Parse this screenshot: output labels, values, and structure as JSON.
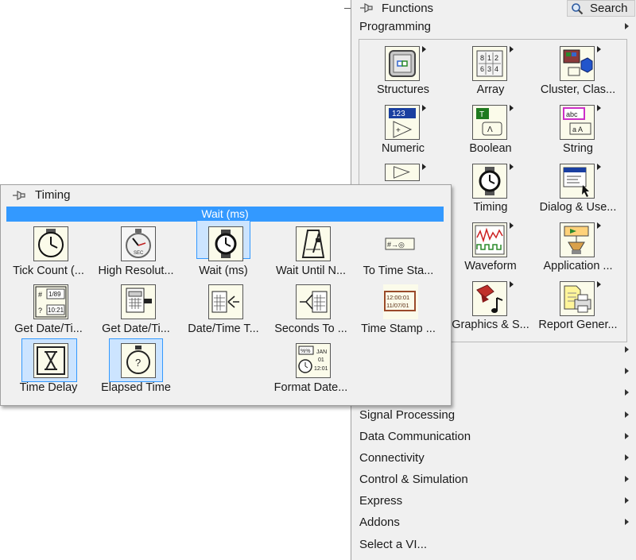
{
  "functions": {
    "title": "Functions",
    "search_label": "Search",
    "top_category": "Programming",
    "programming_items": [
      {
        "label": "Structures",
        "icon": "structures-icon"
      },
      {
        "label": "Array",
        "icon": "array-icon"
      },
      {
        "label": "Cluster, Clas...",
        "icon": "cluster-class-icon"
      },
      {
        "label": "Numeric",
        "icon": "numeric-icon"
      },
      {
        "label": "Boolean",
        "icon": "boolean-icon"
      },
      {
        "label": "String",
        "icon": "string-icon"
      },
      {
        "label": "",
        "icon": "comparison-icon"
      },
      {
        "label": "Timing",
        "icon": "timing-icon"
      },
      {
        "label": "Dialog & Use...",
        "icon": "dialog-ui-icon"
      },
      {
        "label": "",
        "icon": "hidden-icon"
      },
      {
        "label": "Waveform",
        "icon": "waveform-icon"
      },
      {
        "label": "Application ...",
        "icon": "application-control-icon"
      },
      {
        "label": "",
        "icon": "hidden-icon"
      },
      {
        "label": "Graphics & S...",
        "icon": "graphics-sound-icon"
      },
      {
        "label": "Report Gener...",
        "icon": "report-generation-icon"
      }
    ],
    "categories": [
      "Signal Processing",
      "Data Communication",
      "Connectivity",
      "Control & Simulation",
      "Express",
      "Addons",
      "Select a VI..."
    ],
    "partial_fragment": ")"
  },
  "timing": {
    "title": "Timing",
    "highlight_label": "Wait (ms)",
    "items": [
      {
        "label": "Tick Count (...",
        "icon": "tick-count-icon"
      },
      {
        "label": "High Resolut...",
        "icon": "high-resolution-icon"
      },
      {
        "label": "Wait (ms)",
        "icon": "wait-icon"
      },
      {
        "label": "Wait Until N...",
        "icon": "wait-until-next-icon"
      },
      {
        "label": "To Time Sta...",
        "icon": "to-time-stamp-icon"
      },
      {
        "label": "Get Date/Ti...",
        "icon": "get-date-time-string-icon"
      },
      {
        "label": "Get Date/Ti...",
        "icon": "get-date-time-seconds-icon"
      },
      {
        "label": "Date/Time T...",
        "icon": "date-time-to-seconds-icon"
      },
      {
        "label": "Seconds To ...",
        "icon": "seconds-to-date-time-icon"
      },
      {
        "label": "Time Stamp ...",
        "icon": "time-stamp-constant-icon"
      },
      {
        "label": "Time Delay",
        "icon": "time-delay-icon"
      },
      {
        "label": "Elapsed Time",
        "icon": "elapsed-time-icon"
      },
      {
        "label": "Format Date...",
        "icon": "format-date-time-icon"
      }
    ],
    "icon_texts": {
      "date_line1": "1/89",
      "date_line2": "10:21",
      "stamp_line1": "12:00:01",
      "stamp_line2": "11/07/01",
      "format_jan": "JAN",
      "format_01": "01",
      "format_time": "12:01",
      "to_ts_text": "#→◎"
    }
  },
  "colors": {
    "highlight": "#3399ff",
    "selection_fill": "#cce4ff",
    "icon_bg": "#fbfbea"
  }
}
